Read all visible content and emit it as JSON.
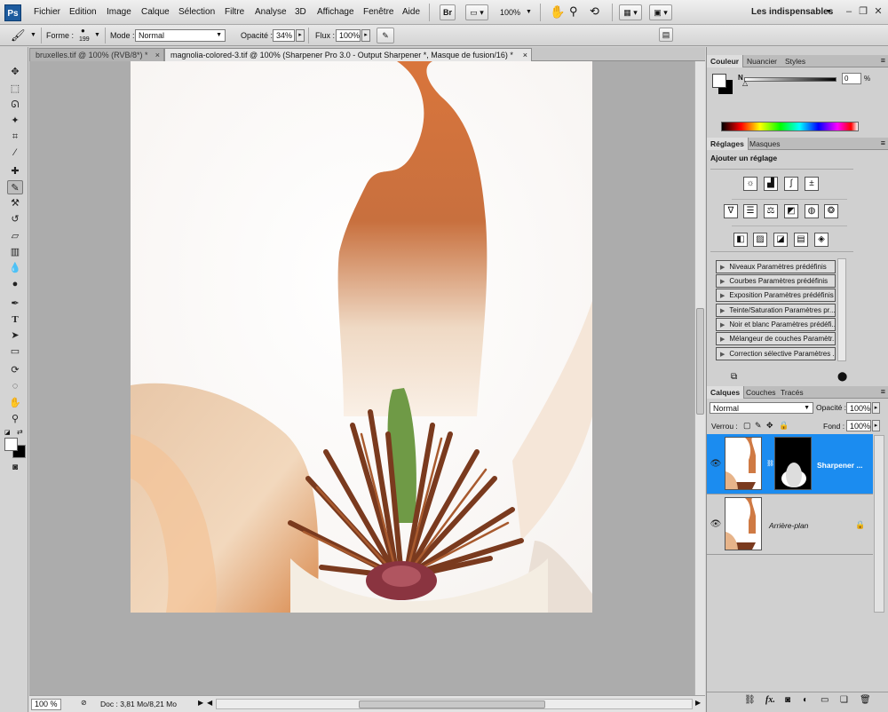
{
  "app": {
    "logo": "Ps"
  },
  "menu": [
    "Fichier",
    "Edition",
    "Image",
    "Calque",
    "Sélection",
    "Filtre",
    "Analyse",
    "3D",
    "Affichage",
    "Fenêtre",
    "Aide"
  ],
  "menubar": {
    "br_label": "Br",
    "zoom": "100%",
    "workspace": "Les indispensables",
    "workspace_arrow": "▼"
  },
  "options": {
    "forme_label": "Forme :",
    "brush_size": "199",
    "mode_label": "Mode :",
    "mode_value": "Normal",
    "opacite_label": "Opacité :",
    "opacite_value": "34%",
    "flux_label": "Flux :",
    "flux_value": "100%"
  },
  "tabs": [
    {
      "label": "bruxelles.tif @ 100% (RVB/8*) *"
    },
    {
      "label": "magnolia-colored-3.tif @ 100% (Sharpener Pro 3.0 - Output Sharpener *, Masque de fusion/16) *"
    }
  ],
  "status": {
    "zoom": "100 %",
    "doc": "Doc : 3,81 Mo/8,21 Mo"
  },
  "couleur_panel": {
    "tabs": [
      "Couleur",
      "Nuancier",
      "Styles"
    ],
    "channel": "N",
    "value": "0",
    "unit": "%"
  },
  "reglages_panel": {
    "tabs": [
      "Réglages",
      "Masques"
    ],
    "title": "Ajouter un réglage",
    "presets": [
      "Niveaux Paramètres prédéfinis",
      "Courbes Paramètres prédéfinis",
      "Exposition Paramètres prédéfinis",
      "Teinte/Saturation Paramètres pr...",
      "Noir et blanc Paramètres prédéfi...",
      "Mélangeur de couches Paramètr...",
      "Correction sélective Paramètres ..."
    ]
  },
  "calques_panel": {
    "tabs": [
      "Calques",
      "Couches",
      "Tracés"
    ],
    "blend_mode": "Normal",
    "opacite_label": "Opacité :",
    "opacite_value": "100%",
    "verrou_label": "Verrou :",
    "fond_label": "Fond :",
    "fond_value": "100%",
    "layers": [
      {
        "name": "Sharpener ...",
        "selected": true
      },
      {
        "name": "Arrière-plan",
        "selected": false
      }
    ],
    "footer_icons": [
      "link-icon",
      "fx-icon",
      "mask-icon",
      "adjustment-icon",
      "folder-icon",
      "new-layer-icon",
      "trash-icon"
    ]
  },
  "colors": {
    "selection": "#1b8cf0",
    "ps_blue": "#1d5b9e",
    "canvas_bg": "#acacac"
  }
}
